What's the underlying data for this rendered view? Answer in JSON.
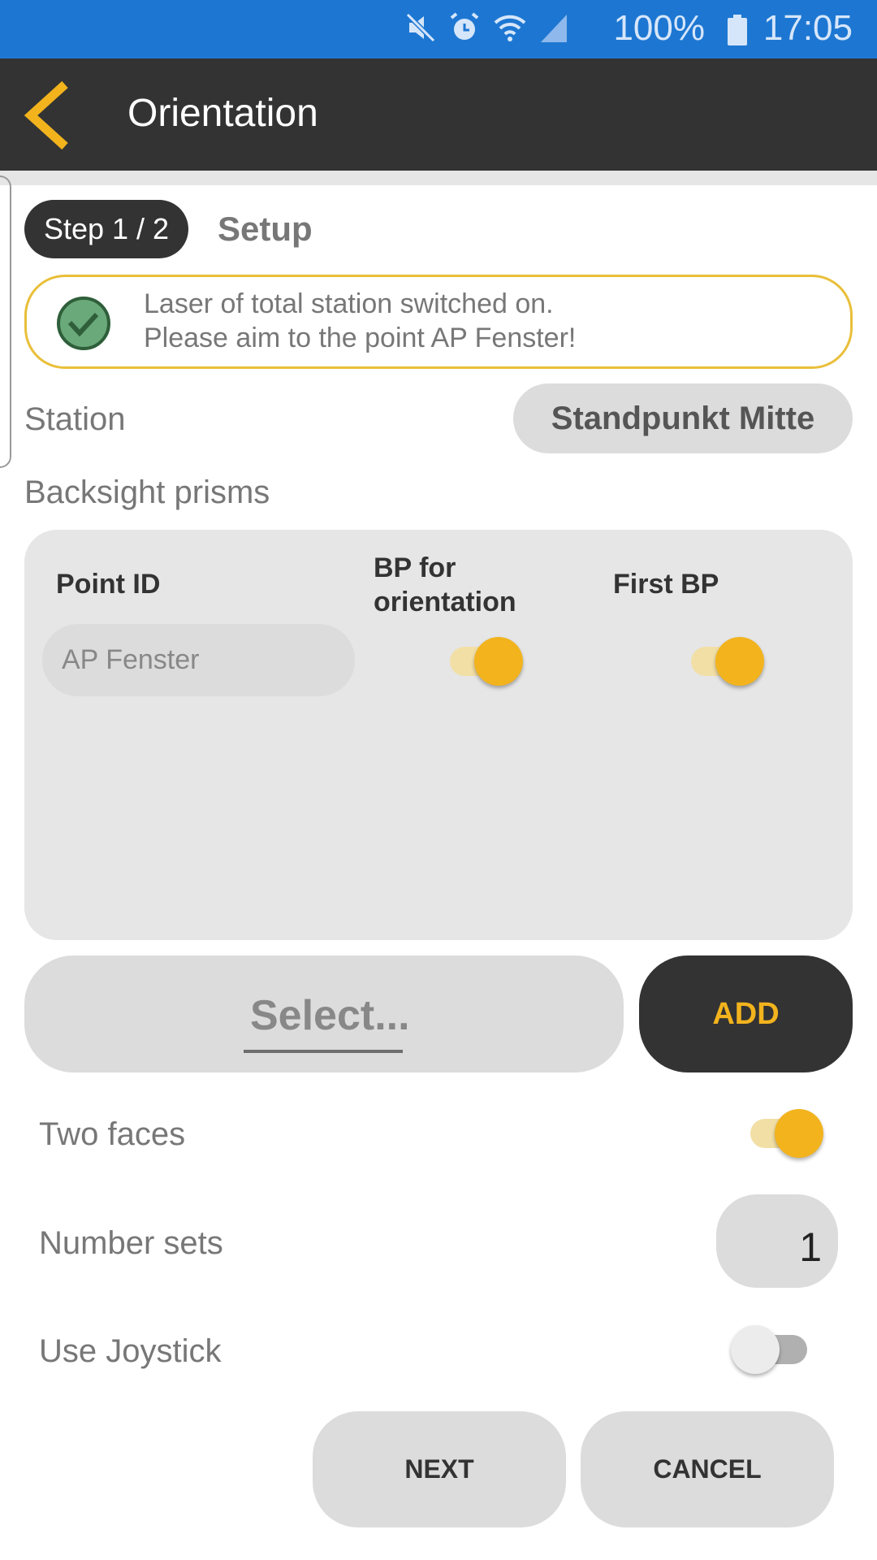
{
  "status_bar": {
    "icons": [
      "mute-icon",
      "alarm-icon",
      "wifi-icon",
      "signal-icon",
      "battery-icon"
    ],
    "battery": "100%",
    "time": "17:05"
  },
  "app_bar": {
    "title": "Orientation",
    "back_icon": "chevron-left-icon"
  },
  "step": {
    "label": "Step 1 / 2",
    "title": "Setup"
  },
  "banner": {
    "line1": "Laser of total station switched on.",
    "line2": "Please aim to the point AP Fenster!",
    "icon": "check-circle-icon"
  },
  "station": {
    "label": "Station",
    "value": "Standpunkt Mitte"
  },
  "backsight": {
    "label": "Backsight prisms",
    "columns": {
      "point_id": "Point ID",
      "bp_orientation_line1": "BP for",
      "bp_orientation_line2": "orientation",
      "first_bp": "First BP"
    },
    "rows": [
      {
        "point_id": "AP Fenster",
        "bp_for_orientation": true,
        "first_bp": true
      }
    ]
  },
  "select": {
    "placeholder": "Select...",
    "add_label": "ADD"
  },
  "options": {
    "two_faces": {
      "label": "Two faces",
      "value": true
    },
    "number_sets": {
      "label": "Number sets",
      "value": "1"
    },
    "use_joystick": {
      "label": "Use Joystick",
      "value": false
    }
  },
  "footer": {
    "next_label": "NEXT",
    "cancel_label": "CANCEL"
  },
  "colors": {
    "accent": "#f2b31d",
    "status_bar": "#1d77d2",
    "app_bar": "#333333",
    "success": "#6aa97a"
  }
}
